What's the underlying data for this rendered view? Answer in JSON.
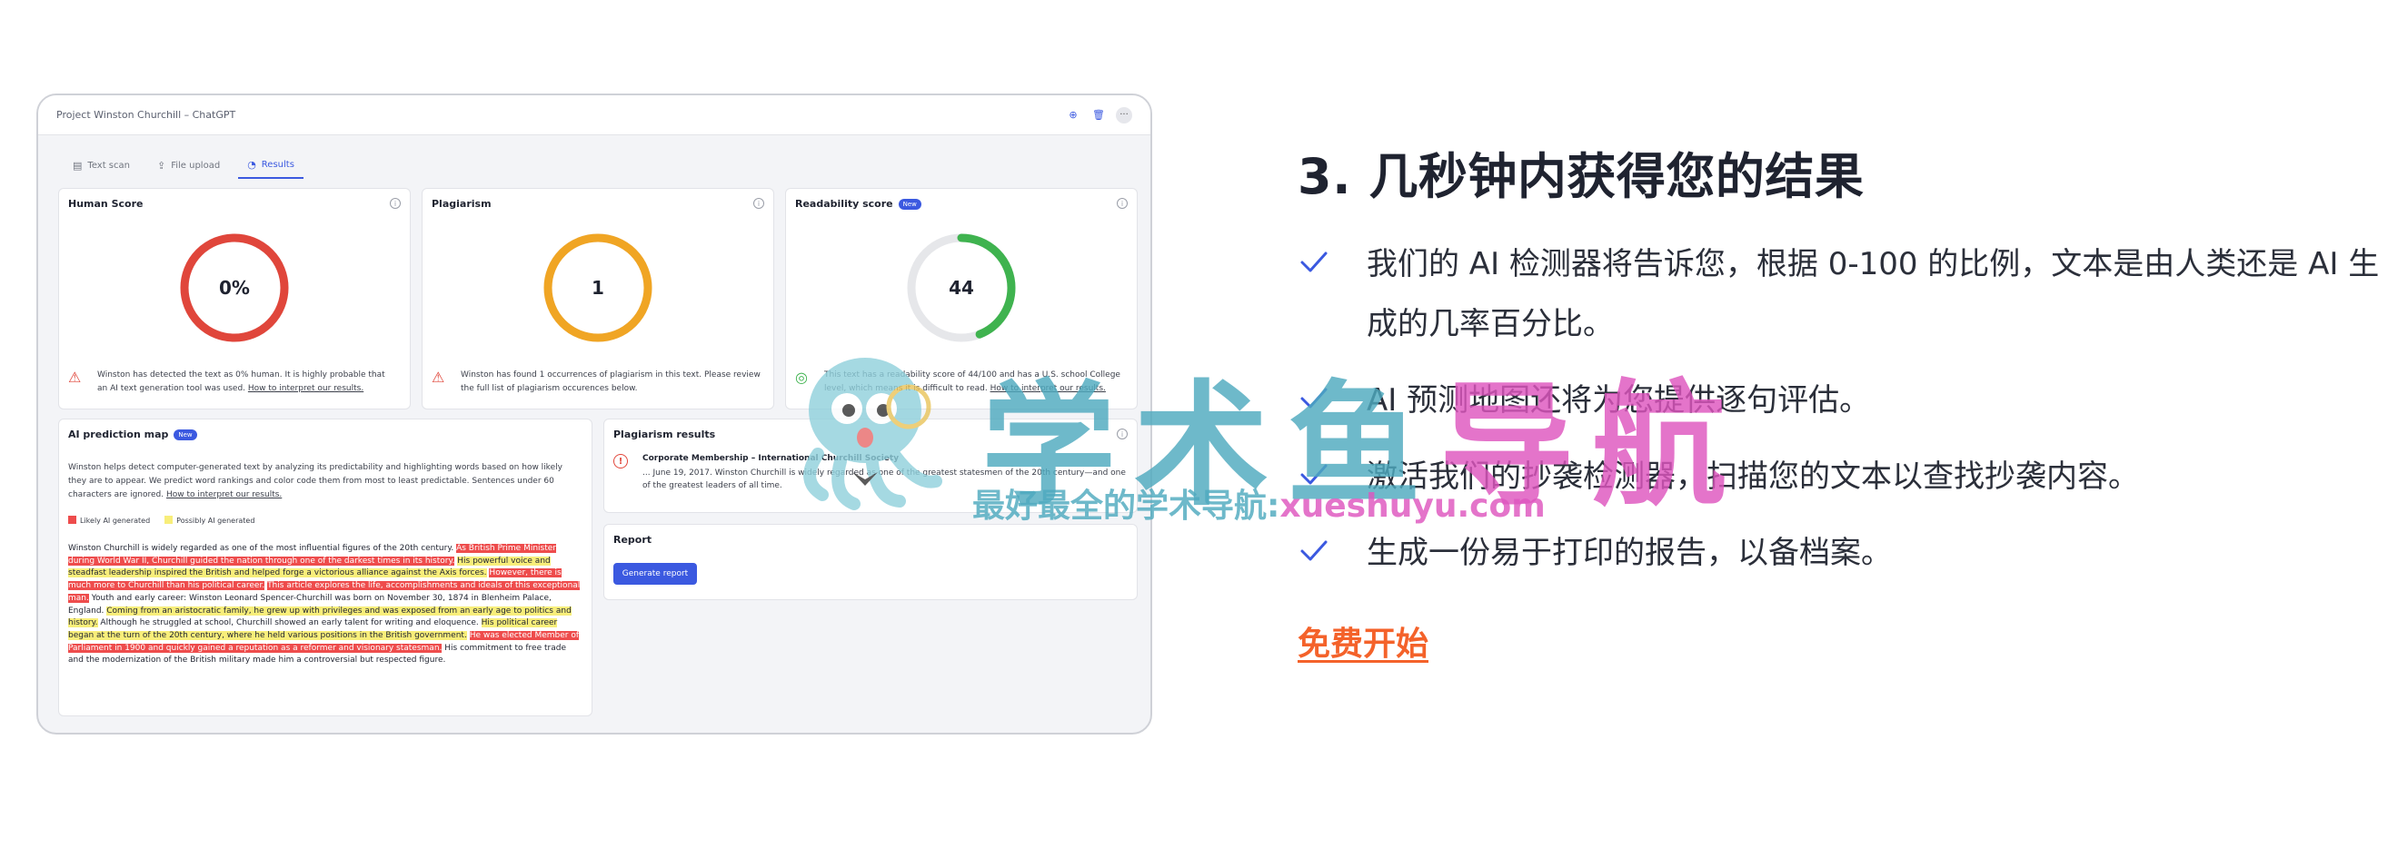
{
  "app": {
    "title": "Project Winston Churchill – ChatGPT",
    "tabs": [
      {
        "label": "Text scan",
        "icon": "document-icon"
      },
      {
        "label": "File upload",
        "icon": "upload-icon"
      },
      {
        "label": "Results",
        "icon": "results-icon",
        "active": true
      }
    ]
  },
  "cards": {
    "human": {
      "title": "Human Score",
      "value": "0%",
      "fraction": 1.0,
      "color": "#e0463b",
      "note": "Winston has detected the text as 0% human. It is highly probable that an AI text generation tool was used.",
      "link": "How to interpret our results."
    },
    "plagiarism": {
      "title": "Plagiarism",
      "value": "1",
      "fraction": 1.0,
      "color": "#f0a524",
      "note": "Winston has found 1 occurrences of plagiarism in this text. Please review the full list of plagiarism occurences below."
    },
    "readability": {
      "title": "Readability score",
      "badge": "New",
      "value": "44",
      "fraction": 0.44,
      "color": "#3fb34f",
      "note": "This text has a readability score of 44/100 and has a U.S. school College level, which means it is difficult to read.",
      "link": "How to interpret our results."
    },
    "map": {
      "title": "AI prediction map",
      "badge": "New",
      "desc": "Winston helps detect computer-generated text by analyzing its predictability and highlighting words based on how likely they are to appear. We predict word rankings and color code them from most to least predictable. Sentences under 60 characters are ignored.",
      "link": "How to interpret our results.",
      "legend_likely": "Likely AI generated",
      "legend_possibly": "Possibly AI generated",
      "segments": [
        {
          "text": "Winston Churchill is widely regarded as one of the most influential figures of the 20th century. ",
          "hl": ""
        },
        {
          "text": "As British Prime Minister during World War II, Churchill guided the nation through one of the darkest times in its history.",
          "hl": "r"
        },
        {
          "text": " ",
          "hl": ""
        },
        {
          "text": "His powerful voice and steadfast leadership inspired the British and helped forge a victorious alliance against the Axis forces.",
          "hl": "y"
        },
        {
          "text": " ",
          "hl": ""
        },
        {
          "text": "However, there is much more to Churchill than his political career.",
          "hl": "r"
        },
        {
          "text": " ",
          "hl": ""
        },
        {
          "text": "This article explores the life, accomplishments and ideals of this exceptional man.",
          "hl": "r"
        },
        {
          "text": " Youth and early career: Winston Leonard Spencer-Churchill was born on November 30, 1874 in Blenheim Palace, England. ",
          "hl": ""
        },
        {
          "text": "Coming from an aristocratic family, he grew up with privileges and was exposed from an early age to politics and history.",
          "hl": "y"
        },
        {
          "text": " Although he struggled at school, Churchill showed an early talent for writing and eloquence. ",
          "hl": ""
        },
        {
          "text": "His political career began at the turn of the 20th century, where he held various positions in the British government.",
          "hl": "y"
        },
        {
          "text": " ",
          "hl": ""
        },
        {
          "text": "He was elected Member of Parliament in 1900 and quickly gained a reputation as a reformer and visionary statesman.",
          "hl": "r"
        },
        {
          "text": " His commitment to free trade and the modernization of the British military made him a controversial but respected figure.",
          "hl": ""
        }
      ]
    },
    "plag_results": {
      "title": "Plagiarism results",
      "item_title": "Corporate Membership – International Churchill Society",
      "item_text": "... June 19, 2017. Winston Churchill is widely regarded as one of the greatest statesmen of the 20th century—and one of the greatest leaders of all time."
    },
    "report": {
      "title": "Report",
      "button": "Generate report"
    }
  },
  "right": {
    "heading": "3. 几秒钟内获得您的结果",
    "features": [
      "我们的 AI 检测器将告诉您，根据 0-100 的比例，文本是由人类还是 AI 生成的几率百分比。",
      "AI 预测地图还将为您提供逐句评估。",
      "激活我们的抄袭检测器，扫描您的文本以查找抄袭内容。",
      "生成一份易于打印的报告，以备档案。"
    ],
    "cta": "免费开始"
  },
  "watermark": {
    "big_a": "学术鱼",
    "big_b": "导航",
    "sub_a": "最好最全的学术导航:",
    "sub_b": "xueshuyu.com"
  },
  "colors": {
    "accent": "#3b59e0",
    "cta": "#f4622a",
    "ring_track": "#e6e7ea",
    "highlight_red": "#ee4c4c",
    "highlight_yellow": "#f8ee7a"
  }
}
